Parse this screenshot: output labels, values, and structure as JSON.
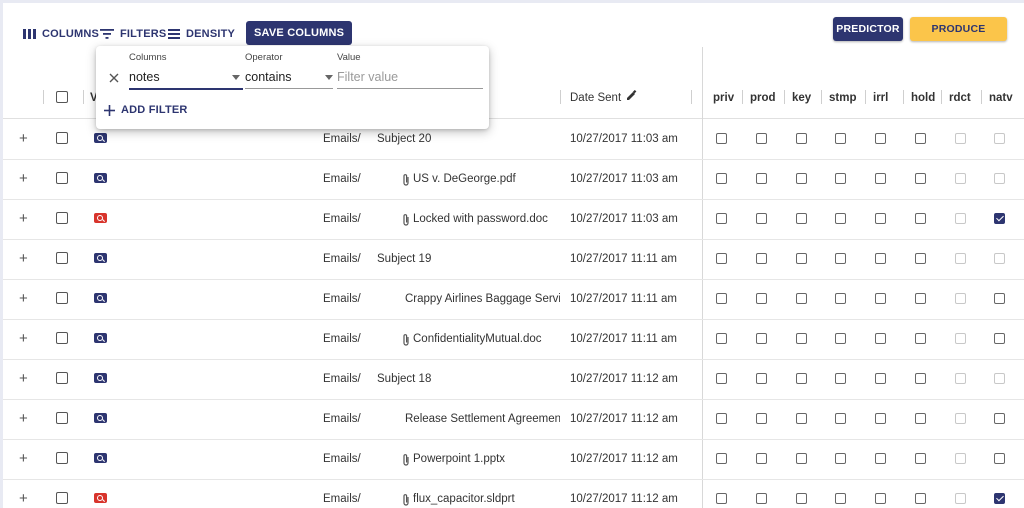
{
  "toolbar": {
    "columns_label": "COLUMNS",
    "filters_label": "FILTERS",
    "density_label": "DENSITY",
    "save_columns_label": "SAVE COLUMNS",
    "predictor_label": "PREDICTOR",
    "produce_label": "PRODUCE"
  },
  "filter_popup": {
    "columns_label": "Columns",
    "columns_value": "notes",
    "operator_label": "Operator",
    "operator_value": "contains",
    "value_label": "Value",
    "value_placeholder": "Filter value",
    "add_filter_label": "ADD FILTER"
  },
  "header": {
    "v_label": "V",
    "date_sent_label": "Date Sent",
    "tags": [
      "priv",
      "prod",
      "key",
      "stmp",
      "irrl",
      "hold",
      "rdct",
      "natv"
    ]
  },
  "rows": [
    {
      "icon": "blue",
      "folder": "Emails/",
      "name": "Subject 20",
      "attachment": false,
      "date": "10/27/2017 11:03 am",
      "natv": false,
      "natv_enabled": false
    },
    {
      "icon": "blue",
      "folder": "Emails/",
      "name": "US v. DeGeorge.pdf",
      "attachment": true,
      "date": "10/27/2017 11:03 am",
      "natv": false,
      "natv_enabled": false
    },
    {
      "icon": "red",
      "folder": "Emails/",
      "name": "Locked with password.doc",
      "attachment": true,
      "date": "10/27/2017 11:03 am",
      "natv": true,
      "natv_enabled": true
    },
    {
      "icon": "blue",
      "folder": "Emails/",
      "name": "Subject 19",
      "attachment": false,
      "date": "10/27/2017 11:11 am",
      "natv": false,
      "natv_enabled": false
    },
    {
      "icon": "blue",
      "folder": "Emails/",
      "name": "Crappy Airlines Baggage Servi",
      "attachment": true,
      "date": "10/27/2017 11:11 am",
      "natv": false,
      "natv_enabled": true
    },
    {
      "icon": "blue",
      "folder": "Emails/",
      "name": "ConfidentialityMutual.doc",
      "attachment": true,
      "date": "10/27/2017 11:11 am",
      "natv": false,
      "natv_enabled": true
    },
    {
      "icon": "blue",
      "folder": "Emails/",
      "name": "Subject 18",
      "attachment": false,
      "date": "10/27/2017 11:12 am",
      "natv": false,
      "natv_enabled": false
    },
    {
      "icon": "blue",
      "folder": "Emails/",
      "name": "Release Settlement Agreemen",
      "attachment": true,
      "date": "10/27/2017 11:12 am",
      "natv": false,
      "natv_enabled": true
    },
    {
      "icon": "blue",
      "folder": "Emails/",
      "name": "Powerpoint 1.pptx",
      "attachment": true,
      "date": "10/27/2017 11:12 am",
      "natv": false,
      "natv_enabled": true
    },
    {
      "icon": "red",
      "folder": "Emails/",
      "name": "flux_capacitor.sldprt",
      "attachment": true,
      "date": "10/27/2017 11:12 am",
      "natv": true,
      "natv_enabled": true
    }
  ],
  "row_expand_symbol": "+",
  "colors": {
    "primary": "#2d3570",
    "accent": "#fbc54a",
    "danger": "#d8342c"
  }
}
